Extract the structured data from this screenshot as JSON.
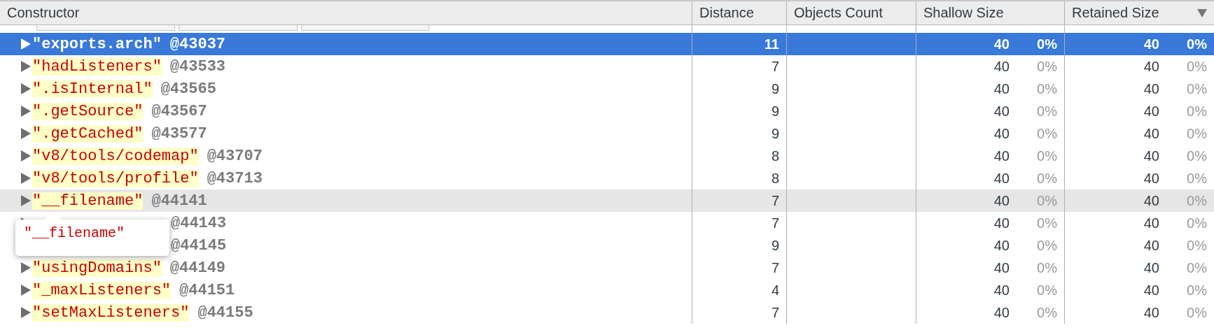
{
  "columns": [
    {
      "label": "Constructor",
      "sorted": false
    },
    {
      "label": "Distance",
      "sorted": false
    },
    {
      "label": "Objects Count",
      "sorted": false
    },
    {
      "label": "Shallow Size",
      "sorted": false
    },
    {
      "label": "Retained Size",
      "sorted": true
    }
  ],
  "rows": [
    {
      "name": "\"exports.arch\"",
      "id": "@43037",
      "distance": "11",
      "shallow_size": "40",
      "shallow_percent": "0%",
      "retained_size": "40",
      "retained_percent": "0%",
      "selected": true,
      "hovered": false
    },
    {
      "name": "\"hadListeners\"",
      "id": "@43533",
      "distance": "7",
      "shallow_size": "40",
      "shallow_percent": "0%",
      "retained_size": "40",
      "retained_percent": "0%",
      "selected": false,
      "hovered": false
    },
    {
      "name": "\".isInternal\"",
      "id": "@43565",
      "distance": "9",
      "shallow_size": "40",
      "shallow_percent": "0%",
      "retained_size": "40",
      "retained_percent": "0%",
      "selected": false,
      "hovered": false
    },
    {
      "name": "\".getSource\"",
      "id": "@43567",
      "distance": "9",
      "shallow_size": "40",
      "shallow_percent": "0%",
      "retained_size": "40",
      "retained_percent": "0%",
      "selected": false,
      "hovered": false
    },
    {
      "name": "\".getCached\"",
      "id": "@43577",
      "distance": "9",
      "shallow_size": "40",
      "shallow_percent": "0%",
      "retained_size": "40",
      "retained_percent": "0%",
      "selected": false,
      "hovered": false
    },
    {
      "name": "\"v8/tools/codemap\"",
      "id": "@43707",
      "distance": "8",
      "shallow_size": "40",
      "shallow_percent": "0%",
      "retained_size": "40",
      "retained_percent": "0%",
      "selected": false,
      "hovered": false
    },
    {
      "name": "\"v8/tools/profile\"",
      "id": "@43713",
      "distance": "8",
      "shallow_size": "40",
      "shallow_percent": "0%",
      "retained_size": "40",
      "retained_percent": "0%",
      "selected": false,
      "hovered": false
    },
    {
      "name": "\"__filename\"",
      "id": "@44141",
      "distance": "7",
      "shallow_size": "40",
      "shallow_percent": "0%",
      "retained_size": "40",
      "retained_percent": "0%",
      "selected": false,
      "hovered": true
    },
    {
      "id": "@44143",
      "distance": "7",
      "shallow_size": "40",
      "shallow_percent": "0%",
      "retained_size": "40",
      "retained_percent": "0%",
      "selected": false,
      "hovered": false
    },
    {
      "id": "@44145",
      "distance": "9",
      "shallow_size": "40",
      "shallow_percent": "0%",
      "retained_size": "40",
      "retained_percent": "0%",
      "selected": false,
      "hovered": false
    },
    {
      "name": "\"usingDomains\"",
      "id": "@44149",
      "distance": "7",
      "shallow_size": "40",
      "shallow_percent": "0%",
      "retained_size": "40",
      "retained_percent": "0%",
      "selected": false,
      "hovered": false
    },
    {
      "name": "\"_maxListeners\"",
      "id": "@44151",
      "distance": "4",
      "shallow_size": "40",
      "shallow_percent": "0%",
      "retained_size": "40",
      "retained_percent": "0%",
      "selected": false,
      "hovered": false
    },
    {
      "name": "\"setMaxListeners\"",
      "id": "@44155",
      "distance": "7",
      "shallow_size": "40",
      "shallow_percent": "0%",
      "retained_size": "40",
      "retained_percent": "0%",
      "selected": false,
      "hovered": false
    }
  ],
  "tooltip": {
    "text": "\"__filename\""
  }
}
